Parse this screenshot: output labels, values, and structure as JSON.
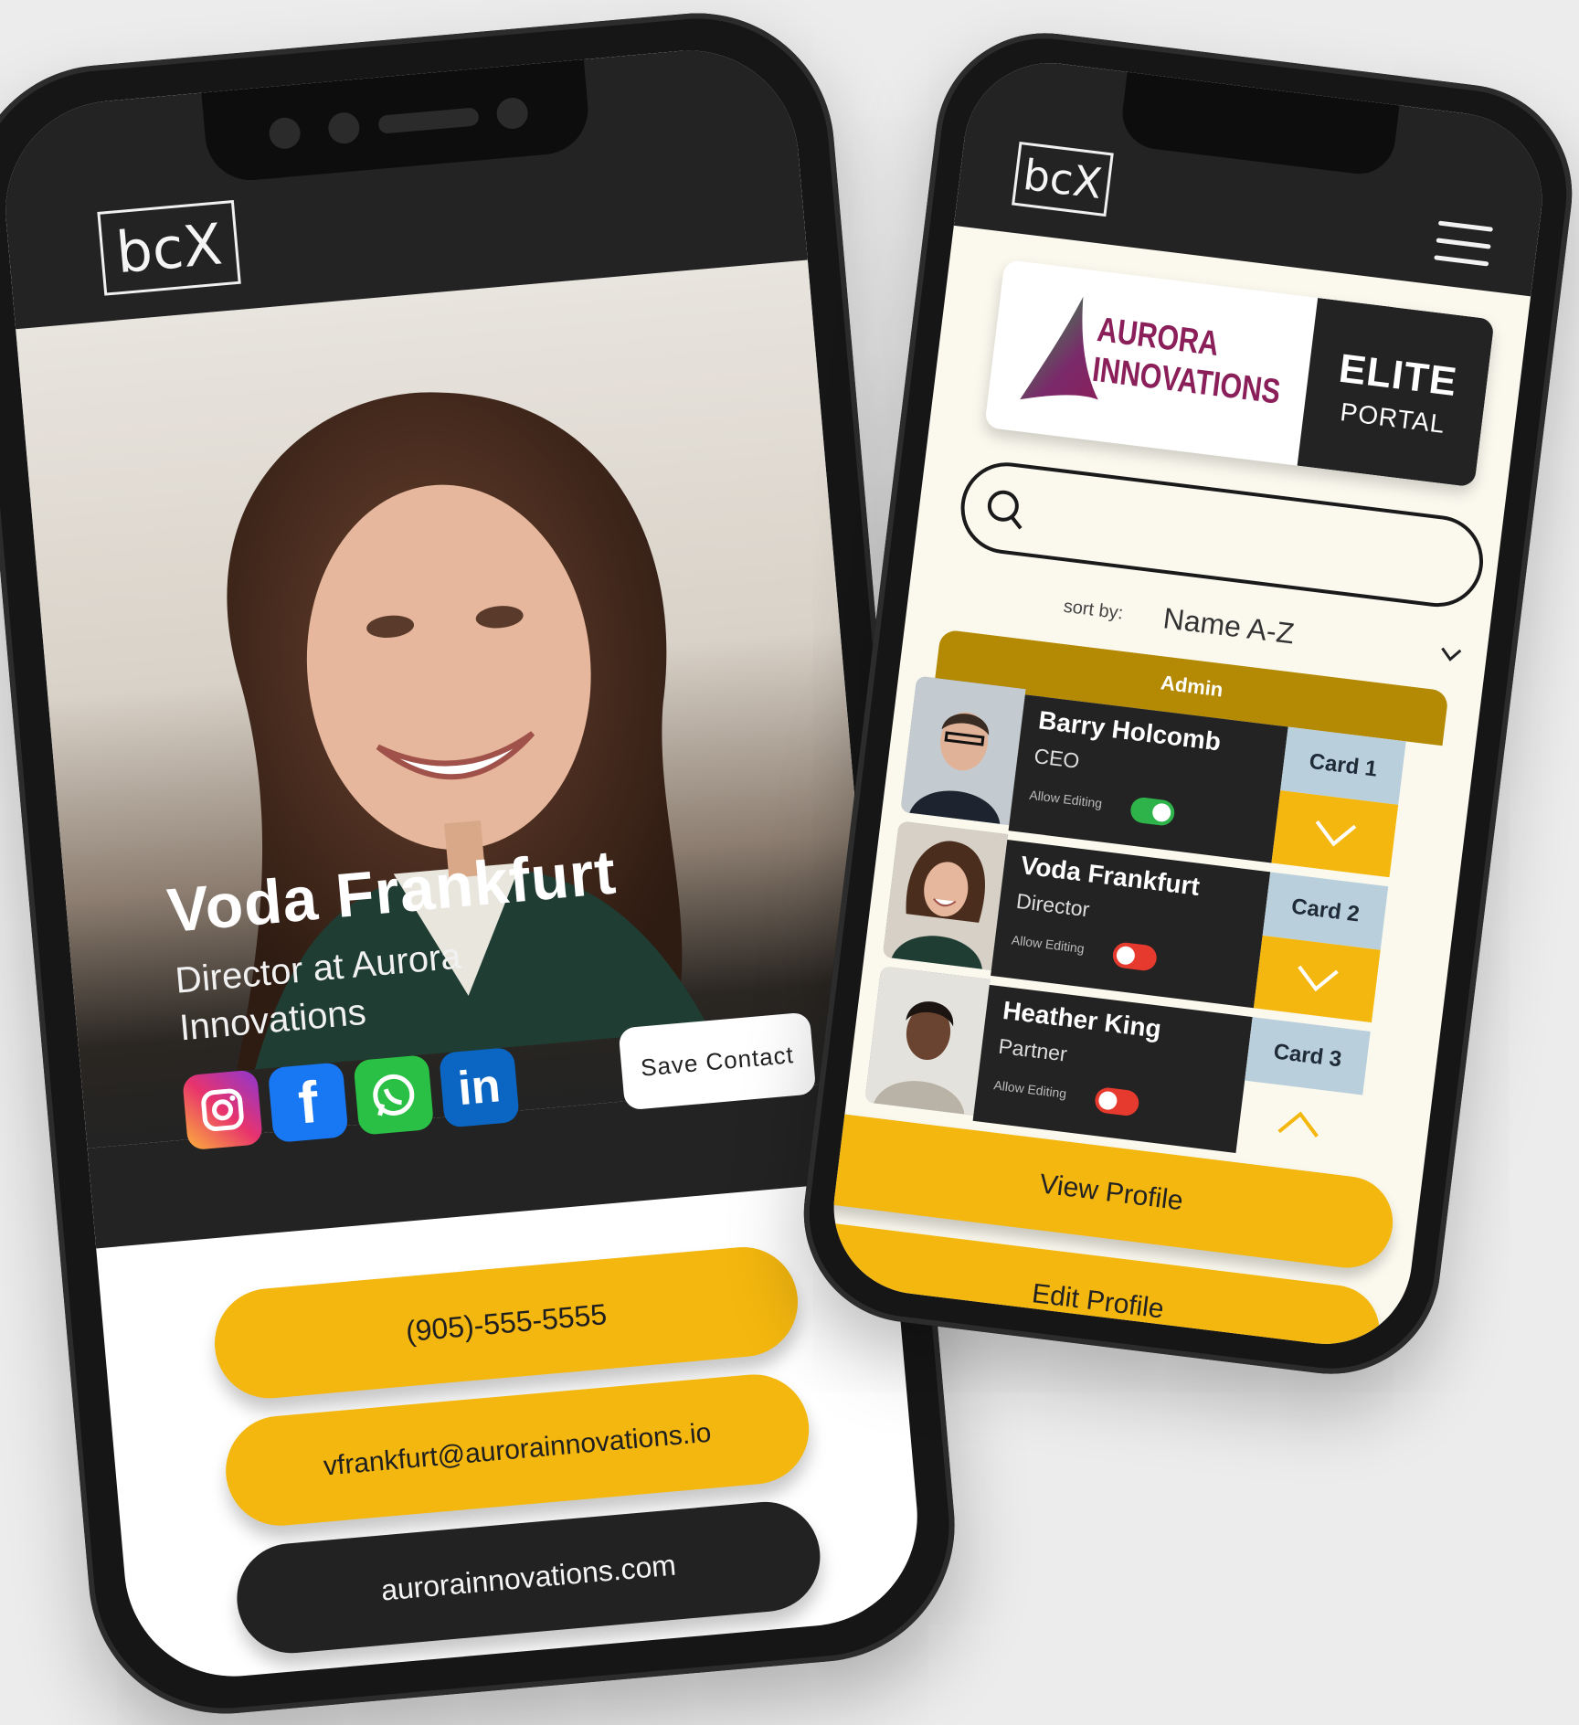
{
  "left_app": {
    "logo": "bcX",
    "name": "Voda Frankfurt",
    "title": "Director at Aurora Innovations",
    "save_contact": "Save Contact",
    "phone": "(905)-555-5555",
    "email": "vfrankfurt@aurorainnovations.io",
    "website": "aurorainnovations.com",
    "socials": [
      {
        "icon": "instagram-icon"
      },
      {
        "icon": "facebook-icon",
        "glyph": "f"
      },
      {
        "icon": "whatsapp-icon"
      },
      {
        "icon": "linkedin-icon",
        "glyph": "in"
      }
    ]
  },
  "right_app": {
    "logo": "bcX",
    "brand": {
      "line1": "AURORA",
      "line2": "INNOVATIONS",
      "tier": "ELITE",
      "portal": "PORTAL"
    },
    "search": {
      "placeholder": ""
    },
    "sort": {
      "label": "sort by:",
      "value": "Name A-Z"
    },
    "admin_label": "Admin",
    "members": [
      {
        "name": "Barry Holcomb",
        "role": "CEO",
        "allow": "Allow Editing",
        "editing": true,
        "card": "Card 1",
        "expanded": false
      },
      {
        "name": "Voda Frankfurt",
        "role": "Director",
        "allow": "Allow Editing",
        "editing": false,
        "card": "Card 2",
        "expanded": false
      },
      {
        "name": "Heather King",
        "role": "Partner",
        "allow": "Allow Editing",
        "editing": false,
        "card": "Card 3",
        "expanded": true
      }
    ],
    "view_profile": "View Profile",
    "edit_profile": "Edit Profile"
  },
  "colors": {
    "accent": "#f4b70f",
    "dark": "#232323",
    "brand": "#8a1f5a",
    "admin": "#b48a05"
  }
}
